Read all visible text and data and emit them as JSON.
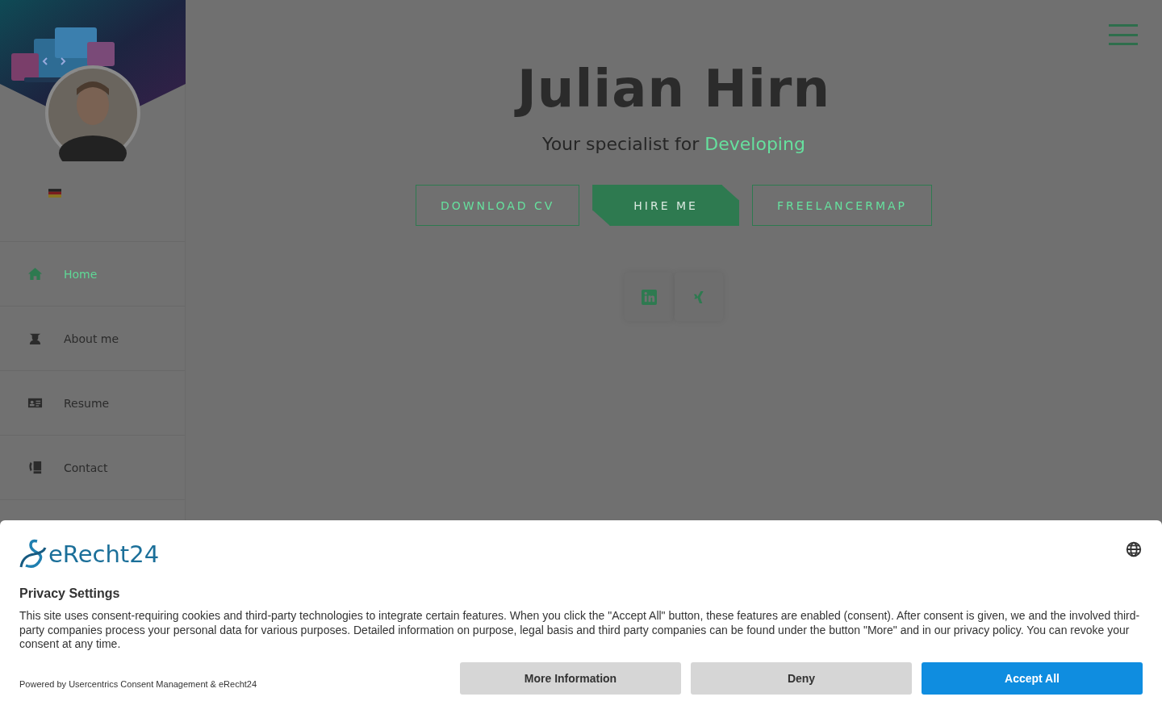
{
  "sidebar": {
    "items": [
      {
        "label": "Home",
        "kind": "home",
        "selected": true
      },
      {
        "label": "About me",
        "kind": "student",
        "selected": false
      },
      {
        "label": "Resume",
        "kind": "card",
        "selected": false
      },
      {
        "label": "Contact",
        "kind": "phone",
        "selected": false
      }
    ]
  },
  "hero": {
    "title": "Julian Hirn",
    "subtitle": "Your specialist for",
    "highlight": "Developing",
    "buttons": [
      {
        "label": "DOWNLOAD CV",
        "kind": "outline"
      },
      {
        "label": "HIRE ME",
        "kind": "filled"
      },
      {
        "label": "FREELANCERMAP",
        "kind": "outline"
      }
    ],
    "social": [
      {
        "kind": "linkedin"
      },
      {
        "kind": "xing"
      }
    ]
  },
  "consent": {
    "brand": "eRecht24",
    "title": "Privacy Settings",
    "text": "This site uses consent-requiring cookies and third-party technologies to integrate certain features. When you click the \"Accept All\" button, these features are enabled (consent). After consent is given, we and the involved third-party companies process your personal data for various purposes. Detailed information on purpose, legal basis and third party companies can be found under the button \"More\" and in our privacy policy. You can revoke your consent at any time.",
    "powered": "Powered by Usercentrics Consent Management & eRecht24",
    "buttons": [
      {
        "label": "More Information",
        "kind": "secondary"
      },
      {
        "label": "Deny",
        "kind": "secondary"
      },
      {
        "label": "Accept All",
        "kind": "primary"
      }
    ]
  }
}
